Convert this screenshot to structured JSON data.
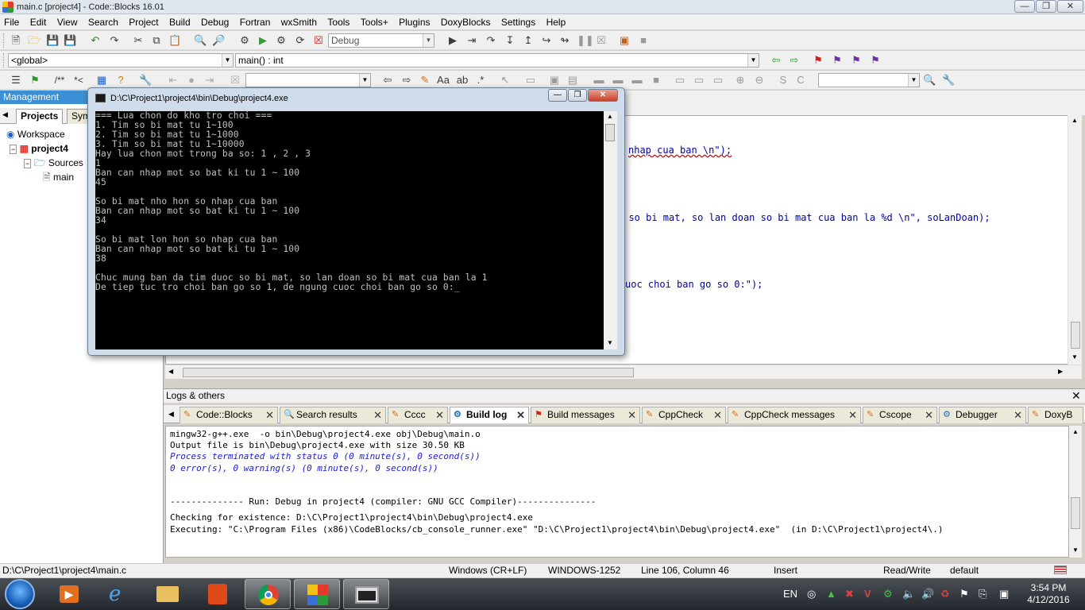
{
  "window": {
    "title": "main.c [project4] - Code::Blocks 16.01"
  },
  "menu": [
    "File",
    "Edit",
    "View",
    "Search",
    "Project",
    "Build",
    "Debug",
    "Fortran",
    "wxSmith",
    "Tools",
    "Tools+",
    "Plugins",
    "DoxyBlocks",
    "Settings",
    "Help"
  ],
  "toolbar": {
    "build_target": "Debug",
    "scope": "<global>",
    "function": "main() : int"
  },
  "management": {
    "title": "Management",
    "tabs": [
      "Projects",
      "Sym"
    ],
    "tree": {
      "workspace": "Workspace",
      "project": "project4",
      "sources": "Sources",
      "file": "main"
    }
  },
  "editor": {
    "lines": [
      {
        "pre": "nhap cua ban \\n\");",
        "kind": "a"
      },
      {
        "pre": "c so bi mat, so lan doan so bi mat cua ban la %d \\n\", soLanDoan);",
        "kind": "b"
      },
      {
        "pre": "uoc choi ban go so 0:\");",
        "kind": "c"
      }
    ]
  },
  "console": {
    "title": "D:\\C\\Project1\\project4\\bin\\Debug\\project4.exe",
    "lines": [
      "=== Lua chon do kho tro choi ===",
      "1. Tim so bi mat tu 1~100",
      "2. Tim so bi mat tu 1~1000",
      "3. Tim so bi mat tu 1~10000",
      "Hay lua chon mot trong ba so: 1 , 2 , 3",
      "1",
      "Ban can nhap mot so bat ki tu 1 ~ 100",
      "45",
      "",
      "So bi mat nho hon so nhap cua ban",
      "Ban can nhap mot so bat ki tu 1 ~ 100",
      "34",
      "",
      "So bi mat lon hon so nhap cua ban",
      "Ban can nhap mot so bat ki tu 1 ~ 100",
      "38",
      "",
      "Chuc mung ban da tim duoc so bi mat, so lan doan so bi mat cua ban la 1",
      "De tiep tuc tro choi ban go so 1, de ngung cuoc choi ban go so 0:_"
    ]
  },
  "logs": {
    "title": "Logs & others",
    "tabs": [
      "Code::Blocks",
      "Search results",
      "Cccc",
      "Build log",
      "Build messages",
      "CppCheck",
      "CppCheck messages",
      "Cscope",
      "Debugger",
      "DoxyB"
    ],
    "active_tab": "Build log",
    "lines": [
      {
        "text": "mingw32-g++.exe  -o bin\\Debug\\project4.exe obj\\Debug\\main.o",
        "style": "normal"
      },
      {
        "text": "Output file is bin\\Debug\\project4.exe with size 30.50 KB",
        "style": "normal"
      },
      {
        "text": "Process terminated with status 0 (0 minute(s), 0 second(s))",
        "style": "blue"
      },
      {
        "text": "0 error(s), 0 warning(s) (0 minute(s), 0 second(s))",
        "style": "blue"
      },
      {
        "text": "",
        "style": "normal"
      },
      {
        "text": "",
        "style": "normal"
      },
      {
        "text": "-------------- Run: Debug in project4 (compiler: GNU GCC Compiler)---------------",
        "style": "normal"
      },
      {
        "text": "",
        "style": "normal"
      },
      {
        "text": "Checking for existence: D:\\C\\Project1\\project4\\bin\\Debug\\project4.exe",
        "style": "normal"
      },
      {
        "text": "Executing: \"C:\\Program Files (x86)\\CodeBlocks/cb_console_runner.exe\" \"D:\\C\\Project1\\project4\\bin\\Debug\\project4.exe\"  (in D:\\C\\Project1\\project4\\.)",
        "style": "normal"
      }
    ]
  },
  "status": {
    "path": "D:\\C\\Project1\\project4\\main.c",
    "eol": "Windows (CR+LF)",
    "encoding": "WINDOWS-1252",
    "position": "Line 106, Column 46",
    "mode": "Insert",
    "access": "Read/Write",
    "profile": "default"
  },
  "taskbar": {
    "lang": "EN",
    "time": "3:54 PM",
    "date": "4/12/2016"
  }
}
